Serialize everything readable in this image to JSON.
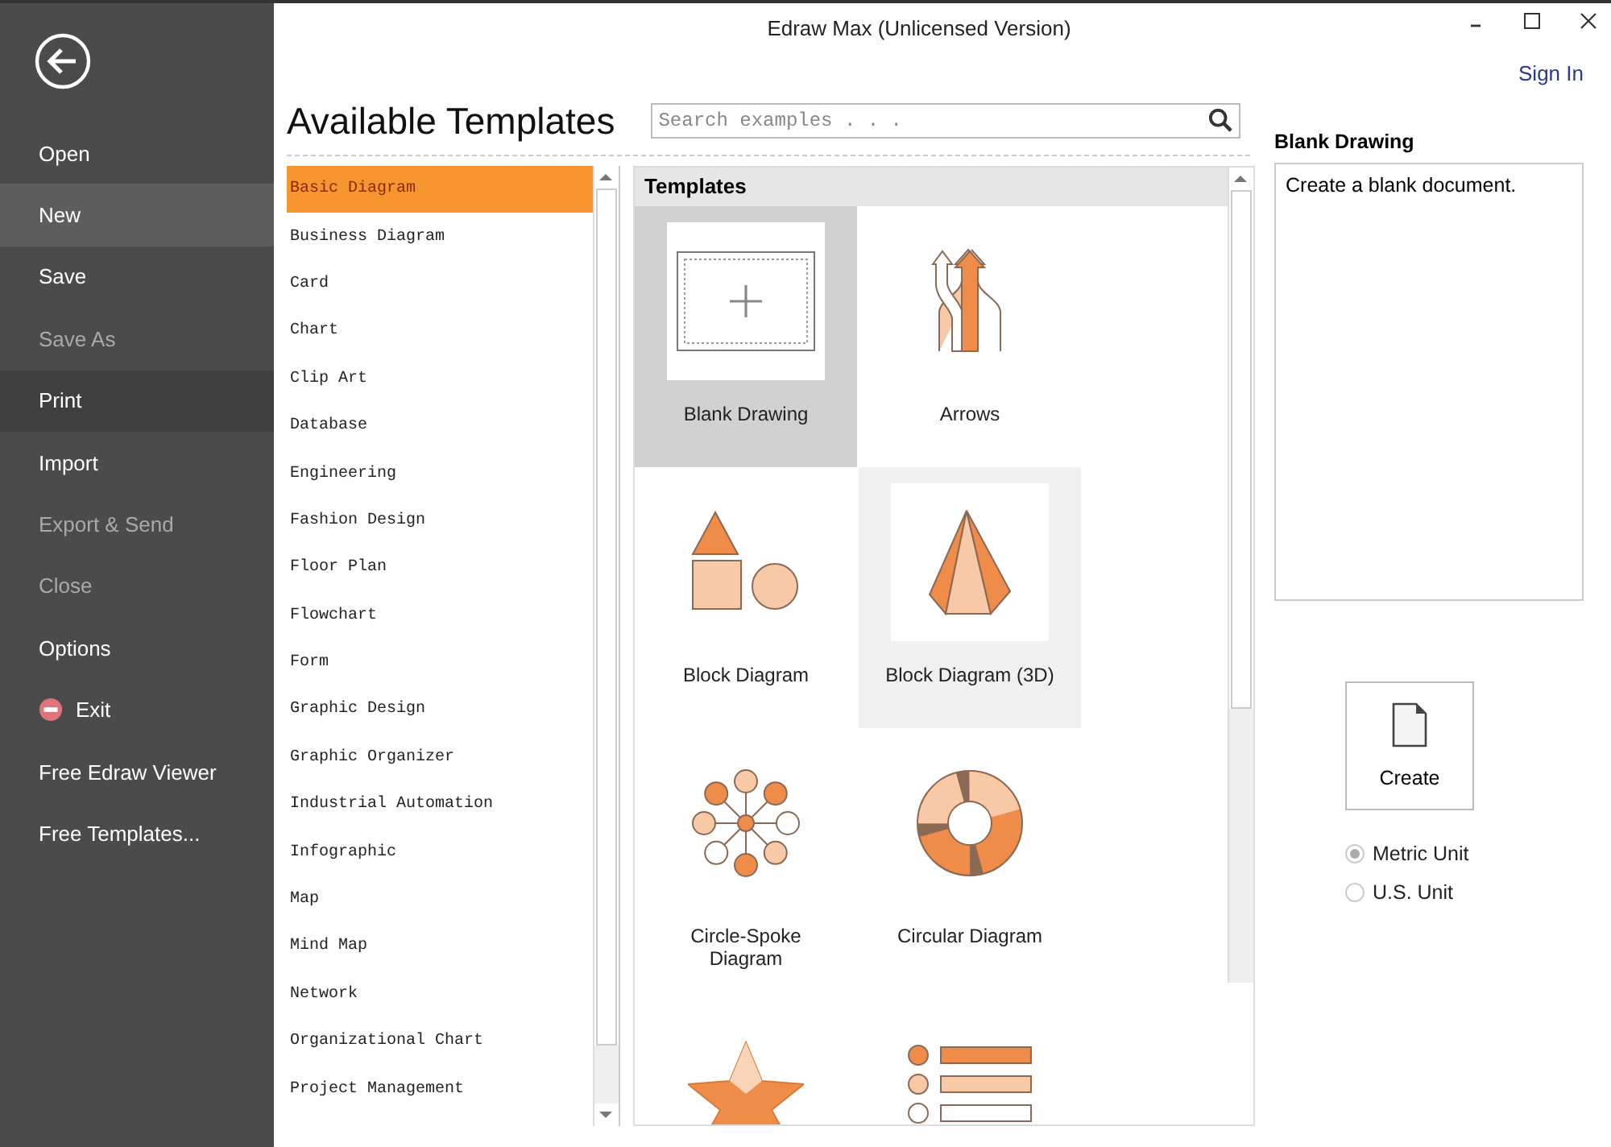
{
  "window": {
    "title": "Edraw Max (Unlicensed Version)"
  },
  "sign_in": "Sign In",
  "sidebar": {
    "items": [
      {
        "label": "Open",
        "selected": false,
        "hover": false,
        "disabled": false,
        "kind": "plain"
      },
      {
        "label": "New",
        "selected": true,
        "hover": false,
        "disabled": false,
        "kind": "plain"
      },
      {
        "label": "Save",
        "selected": false,
        "hover": false,
        "disabled": false,
        "kind": "plain"
      },
      {
        "label": "Save As",
        "selected": false,
        "hover": false,
        "disabled": true,
        "kind": "plain"
      },
      {
        "label": "Print",
        "selected": false,
        "hover": true,
        "disabled": false,
        "kind": "plain"
      },
      {
        "label": "Import",
        "selected": false,
        "hover": false,
        "disabled": false,
        "kind": "plain"
      },
      {
        "label": "Export & Send",
        "selected": false,
        "hover": false,
        "disabled": true,
        "kind": "plain"
      },
      {
        "label": "Close",
        "selected": false,
        "hover": false,
        "disabled": true,
        "kind": "plain"
      },
      {
        "label": "Options",
        "selected": false,
        "hover": false,
        "disabled": false,
        "kind": "plain"
      },
      {
        "label": "Exit",
        "selected": false,
        "hover": false,
        "disabled": false,
        "kind": "exit"
      },
      {
        "label": "Free Edraw Viewer",
        "selected": false,
        "hover": false,
        "disabled": false,
        "kind": "plain"
      },
      {
        "label": "Free Templates...",
        "selected": false,
        "hover": false,
        "disabled": false,
        "kind": "plain"
      }
    ]
  },
  "heading": "Available Templates",
  "search": {
    "placeholder": "Search examples . . ."
  },
  "categories": [
    {
      "label": "Basic Diagram",
      "selected": true
    },
    {
      "label": "Business Diagram",
      "selected": false
    },
    {
      "label": "Card",
      "selected": false
    },
    {
      "label": "Chart",
      "selected": false
    },
    {
      "label": "Clip Art",
      "selected": false
    },
    {
      "label": "Database",
      "selected": false
    },
    {
      "label": "Engineering",
      "selected": false
    },
    {
      "label": "Fashion Design",
      "selected": false
    },
    {
      "label": "Floor Plan",
      "selected": false
    },
    {
      "label": "Flowchart",
      "selected": false
    },
    {
      "label": "Form",
      "selected": false
    },
    {
      "label": "Graphic Design",
      "selected": false
    },
    {
      "label": "Graphic Organizer",
      "selected": false
    },
    {
      "label": "Industrial Automation",
      "selected": false
    },
    {
      "label": "Infographic",
      "selected": false
    },
    {
      "label": "Map",
      "selected": false
    },
    {
      "label": "Mind Map",
      "selected": false
    },
    {
      "label": "Network",
      "selected": false
    },
    {
      "label": "Organizational Chart",
      "selected": false
    },
    {
      "label": "Project Management",
      "selected": false
    }
  ],
  "templates": {
    "title": "Templates",
    "items": [
      {
        "label": "Blank Drawing",
        "kind": "blank",
        "selected": true,
        "hover": false
      },
      {
        "label": "Arrows",
        "kind": "arrows",
        "selected": false,
        "hover": false
      },
      {
        "label": "Block Diagram",
        "kind": "blocks",
        "selected": false,
        "hover": false
      },
      {
        "label": "Block Diagram (3D)",
        "kind": "pyramid",
        "selected": false,
        "hover": true
      },
      {
        "label": "Circle-Spoke Diagram",
        "kind": "spoke",
        "selected": false,
        "hover": false
      },
      {
        "label": "Circular Diagram",
        "kind": "ring",
        "selected": false,
        "hover": false
      },
      {
        "kind": "star",
        "selected": false,
        "hover": false
      },
      {
        "kind": "list",
        "selected": false,
        "hover": false
      }
    ]
  },
  "details": {
    "title": "Blank Drawing",
    "description": "Create a blank document."
  },
  "create_button": "Create",
  "units": [
    {
      "label": "Metric Unit",
      "selected": true
    },
    {
      "label": "U.S. Unit",
      "selected": false
    }
  ]
}
